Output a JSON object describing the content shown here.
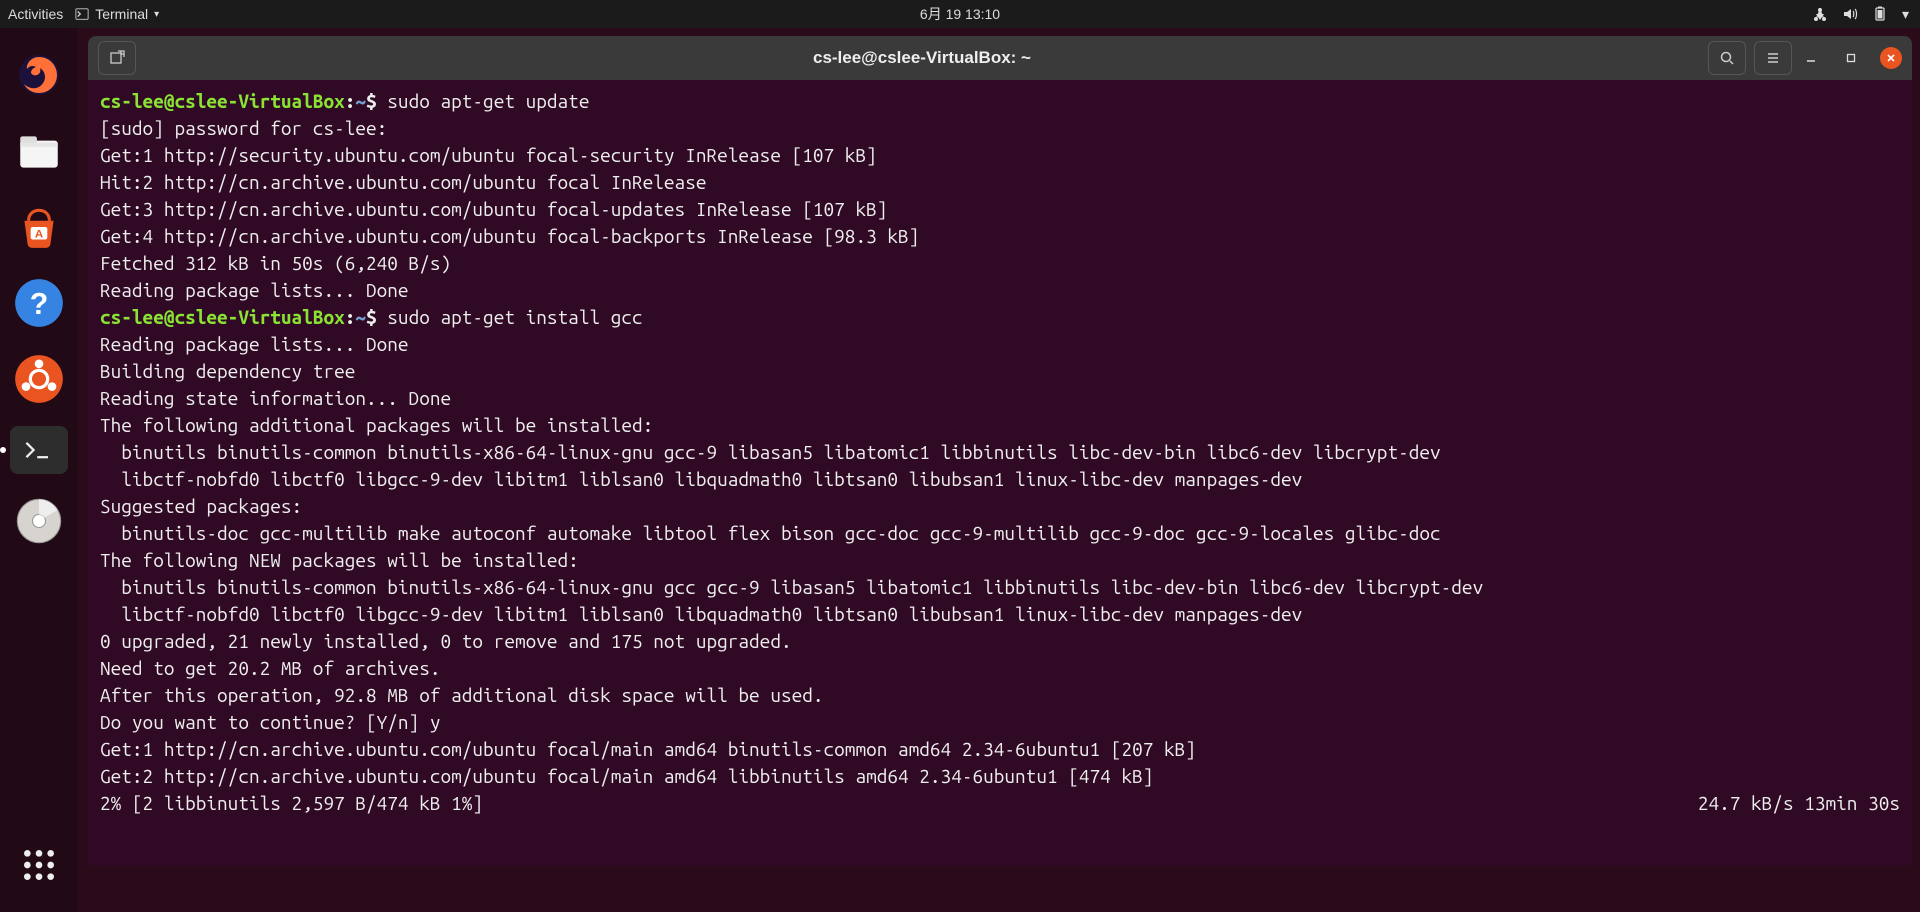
{
  "topbar": {
    "activities": "Activities",
    "app": "Terminal",
    "clock": "6月 19 13:10"
  },
  "window": {
    "title": "cs-lee@cslee-VirtualBox: ~"
  },
  "prompt": {
    "user": "cs-lee@cslee-VirtualBox",
    "path": "~"
  },
  "cmd1": "sudo apt-get update",
  "out1": [
    "[sudo] password for cs-lee:",
    "Get:1 http://security.ubuntu.com/ubuntu focal-security InRelease [107 kB]",
    "Hit:2 http://cn.archive.ubuntu.com/ubuntu focal InRelease",
    "Get:3 http://cn.archive.ubuntu.com/ubuntu focal-updates InRelease [107 kB]",
    "Get:4 http://cn.archive.ubuntu.com/ubuntu focal-backports InRelease [98.3 kB]",
    "Fetched 312 kB in 50s (6,240 B/s)",
    "Reading package lists... Done"
  ],
  "cmd2": "sudo apt-get install gcc",
  "out2": [
    "Reading package lists... Done",
    "Building dependency tree",
    "Reading state information... Done",
    "The following additional packages will be installed:",
    "  binutils binutils-common binutils-x86-64-linux-gnu gcc-9 libasan5 libatomic1 libbinutils libc-dev-bin libc6-dev libcrypt-dev",
    "  libctf-nobfd0 libctf0 libgcc-9-dev libitm1 liblsan0 libquadmath0 libtsan0 libubsan1 linux-libc-dev manpages-dev",
    "Suggested packages:",
    "  binutils-doc gcc-multilib make autoconf automake libtool flex bison gcc-doc gcc-9-multilib gcc-9-doc gcc-9-locales glibc-doc",
    "The following NEW packages will be installed:",
    "  binutils binutils-common binutils-x86-64-linux-gnu gcc gcc-9 libasan5 libatomic1 libbinutils libc-dev-bin libc6-dev libcrypt-dev",
    "  libctf-nobfd0 libctf0 libgcc-9-dev libitm1 liblsan0 libquadmath0 libtsan0 libubsan1 linux-libc-dev manpages-dev",
    "0 upgraded, 21 newly installed, 0 to remove and 175 not upgraded.",
    "Need to get 20.2 MB of archives.",
    "After this operation, 92.8 MB of additional disk space will be used.",
    "Do you want to continue? [Y/n] y",
    "Get:1 http://cn.archive.ubuntu.com/ubuntu focal/main amd64 binutils-common amd64 2.34-6ubuntu1 [207 kB]",
    "Get:2 http://cn.archive.ubuntu.com/ubuntu focal/main amd64 libbinutils amd64 2.34-6ubuntu1 [474 kB]"
  ],
  "status": {
    "left": "2% [2 libbinutils 2,597 B/474 kB 1%]",
    "right": "24.7 kB/s 13min 30s"
  }
}
